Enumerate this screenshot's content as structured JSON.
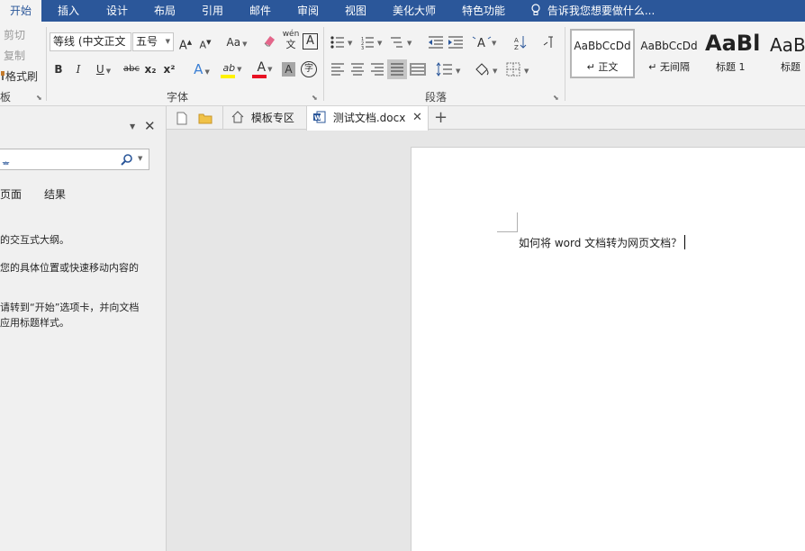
{
  "menubar": {
    "tabs": [
      "开始",
      "插入",
      "设计",
      "布局",
      "引用",
      "邮件",
      "审阅",
      "视图",
      "美化大师",
      "特色功能"
    ],
    "active": "开始",
    "tell_me": "告诉我您想要做什么..."
  },
  "clipboard": {
    "cut": "剪切",
    "copy": "复制",
    "format_painter": "格式刷",
    "group_label": "板"
  },
  "font": {
    "name": "等线 (中文正文",
    "size": "五号",
    "group_label": "字体",
    "bold": "B",
    "italic": "I",
    "underline": "U",
    "strike": "abc",
    "subscript": "x₂",
    "superscript": "x²",
    "case": "Aa",
    "phonetic_top": "wén",
    "phonetic_bottom": "文",
    "char_shading": "A",
    "enclose": "字",
    "grow": "A",
    "shrink": "A",
    "effects": "A",
    "font_color": "A",
    "highlight": "ab"
  },
  "paragraph": {
    "group_label": "段落",
    "sort": "A↓Z"
  },
  "styles": [
    {
      "preview": "AaBbCcDd",
      "name": "↵ 正文"
    },
    {
      "preview": "AaBbCcDd",
      "name": "↵ 无间隔"
    },
    {
      "preview": "AaBl",
      "name": "标题 1"
    },
    {
      "preview": "AaBl",
      "name": "标题"
    }
  ],
  "nav_pane": {
    "search_fragment": "ᇂ",
    "tabs": [
      "页面",
      "结果"
    ],
    "lines": [
      "的交互式大纲。",
      "您的具体位置或快速移动内容的",
      "请转到“开始”选项卡，并向文档",
      "应用标题样式。"
    ]
  },
  "doc_tabs": [
    {
      "label": "模板专区"
    },
    {
      "label": "测试文档.docx"
    }
  ],
  "document": {
    "text": "如何将 word 文档转为网页文档？"
  },
  "colors": {
    "accent": "#2b579a",
    "font_color_bar": "#e81123",
    "highlight_bar": "#fff200"
  }
}
